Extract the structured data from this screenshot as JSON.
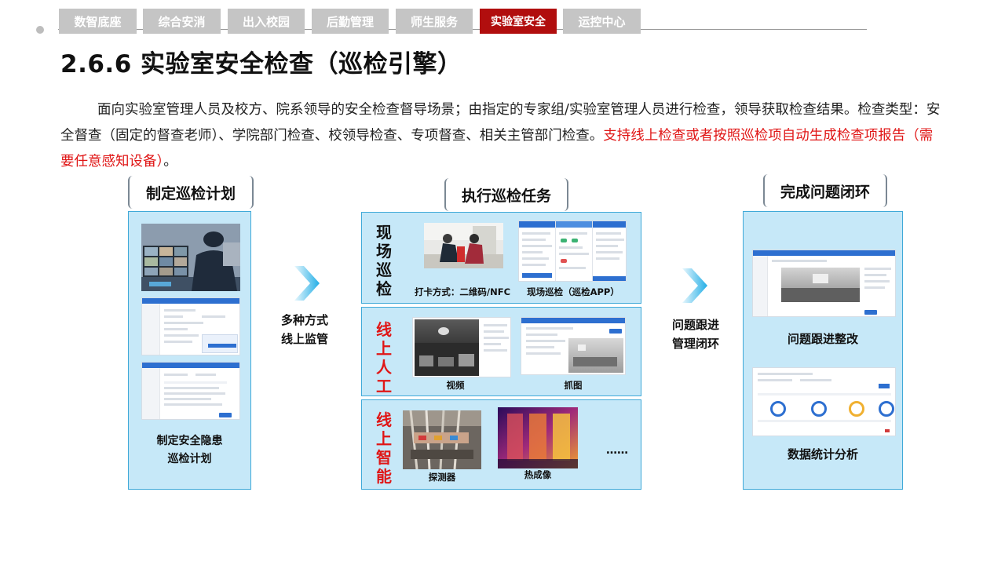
{
  "nav": {
    "tabs": [
      {
        "label": "数智底座",
        "active": false
      },
      {
        "label": "综合安消",
        "active": false
      },
      {
        "label": "出入校园",
        "active": false
      },
      {
        "label": "后勤管理",
        "active": false
      },
      {
        "label": "师生服务",
        "active": false
      },
      {
        "label": "实验室安全",
        "active": true
      },
      {
        "label": "运控中心",
        "active": false
      }
    ]
  },
  "page": {
    "title": "2.6.6 实验室安全检查（巡检引擎）",
    "intro_black": "面向实验室管理人员及校方、院系领导的安全检查督导场景；由指定的专家组/实验室管理人员进行检查，领导获取检查结果。检查类型：安全督查（固定的督查老师）、学院部门检查、校领导检查、专项督查、相关主管部门检查。",
    "intro_red": "支持线上检查或者按照巡检项自动生成检查项报告（需要任意感知设备）",
    "intro_end": "。"
  },
  "flow": {
    "plan": {
      "heading": "制定巡检计划",
      "caption_line1": "制定安全隐患",
      "caption_line2": "巡检计划"
    },
    "arrow1": {
      "line1": "多种方式",
      "line2": "线上监管"
    },
    "execute": {
      "heading": "执行巡检任务",
      "onsite": {
        "side_label": [
          "现",
          "场",
          "巡",
          "检"
        ],
        "caption_nfc": "打卡方式：二维码/NFC",
        "caption_app": "现场巡检（巡检APP）"
      },
      "manual": {
        "side_label": [
          "线",
          "上",
          "人",
          "工"
        ],
        "caption_video": "视频",
        "caption_snapshot": "抓图"
      },
      "smart": {
        "side_label": [
          "线",
          "上",
          "智",
          "能"
        ],
        "caption_detector": "探测器",
        "caption_thermal": "热成像",
        "ellipsis": "……"
      }
    },
    "arrow2": {
      "line1": "问题跟进",
      "line2": "管理闭环"
    },
    "close": {
      "heading": "完成问题闭环",
      "caption_followup": "问题跟进整改",
      "caption_stats": "数据统计分析"
    }
  },
  "colors": {
    "active_tab": "#b10e0e",
    "inactive_tab": "#c5c5c5",
    "highlight_text": "#e01616",
    "panel_fill": "#c6e8f8",
    "panel_border": "#3fa9d8",
    "arrow": "#2bb3e8"
  }
}
